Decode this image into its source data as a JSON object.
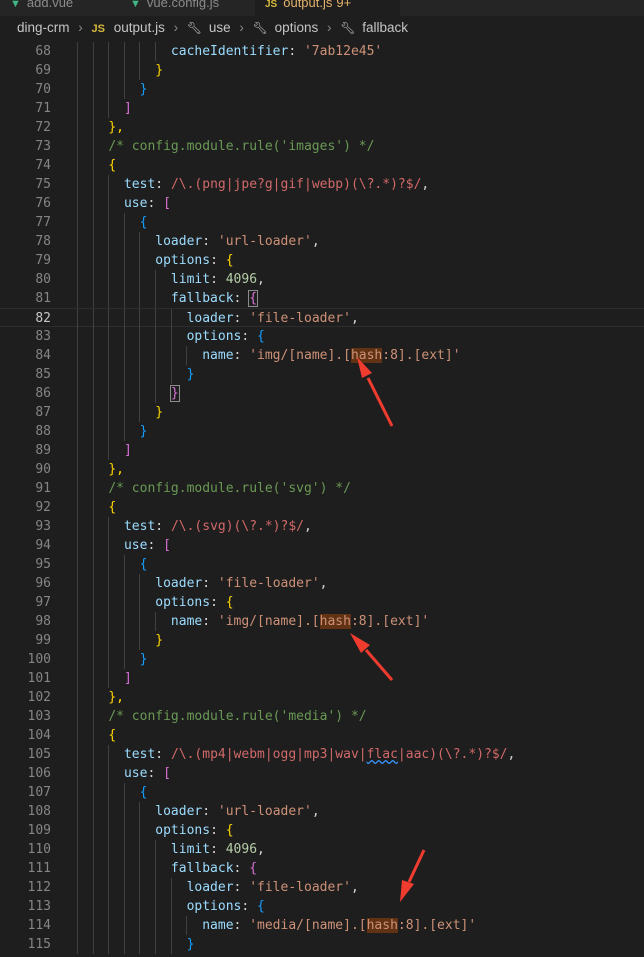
{
  "tabs": [
    {
      "name": "add.vue",
      "icon": "vue-icon",
      "active": false
    },
    {
      "name": "vue.config.js",
      "icon": "vue-icon",
      "active": false
    },
    {
      "name": "output.js",
      "icon": "js-icon",
      "active": true,
      "badge": "9+"
    }
  ],
  "breadcrumb": {
    "items": [
      "ding-crm",
      "output.js",
      "use",
      "options",
      "fallback"
    ],
    "file_icon": "JS"
  },
  "colors": {
    "keyword": "#9cdcfe",
    "string": "#ce9178",
    "number": "#b5cea8",
    "comment": "#6a9955",
    "regex": "#d16969",
    "bracket_gold": "#ffd700",
    "bracket_purple": "#da70d6",
    "bracket_blue": "#179fff",
    "arrow": "#ef3c2f",
    "highlight": "#613214"
  },
  "annotations": [
    "red-arrow",
    "red-arrow",
    "red-arrow"
  ],
  "lines": [
    {
      "n": "68",
      "t": [
        [
          "            ",
          ""
        ],
        [
          "cacheIdentifier",
          "k"
        ],
        [
          ": ",
          "p"
        ],
        [
          "'7ab12e45'",
          "s"
        ]
      ]
    },
    {
      "n": "69",
      "t": [
        [
          "          ",
          ""
        ],
        [
          "}",
          "y"
        ]
      ]
    },
    {
      "n": "70",
      "t": [
        [
          "        ",
          ""
        ],
        [
          "}",
          "b"
        ]
      ]
    },
    {
      "n": "71",
      "t": [
        [
          "      ",
          ""
        ],
        [
          "]",
          "m"
        ]
      ]
    },
    {
      "n": "72",
      "t": [
        [
          "    ",
          ""
        ],
        [
          "},",
          "y"
        ]
      ]
    },
    {
      "n": "73",
      "t": [
        [
          "    ",
          ""
        ],
        [
          "/* config.module.rule('images') */",
          "c"
        ]
      ]
    },
    {
      "n": "74",
      "t": [
        [
          "    ",
          ""
        ],
        [
          "{",
          "y"
        ]
      ]
    },
    {
      "n": "75",
      "t": [
        [
          "      ",
          ""
        ],
        [
          "test",
          "k"
        ],
        [
          ": ",
          "p"
        ],
        [
          "/\\.(png|jpe?g|gif|webp)(\\?.*)?$/",
          "r"
        ],
        [
          ",",
          "p"
        ]
      ]
    },
    {
      "n": "76",
      "t": [
        [
          "      ",
          ""
        ],
        [
          "use",
          "k"
        ],
        [
          ": ",
          "p"
        ],
        [
          "[",
          "m"
        ]
      ]
    },
    {
      "n": "77",
      "t": [
        [
          "        ",
          ""
        ],
        [
          "{",
          "b"
        ]
      ]
    },
    {
      "n": "78",
      "t": [
        [
          "          ",
          ""
        ],
        [
          "loader",
          "k"
        ],
        [
          ": ",
          "p"
        ],
        [
          "'url-loader'",
          "s"
        ],
        [
          ",",
          "p"
        ]
      ]
    },
    {
      "n": "79",
      "t": [
        [
          "          ",
          ""
        ],
        [
          "options",
          "k"
        ],
        [
          ": ",
          "p"
        ],
        [
          "{",
          "y"
        ]
      ]
    },
    {
      "n": "80",
      "t": [
        [
          "            ",
          ""
        ],
        [
          "limit",
          "k"
        ],
        [
          ": ",
          "p"
        ],
        [
          "4096",
          "n"
        ],
        [
          ",",
          "p"
        ]
      ]
    },
    {
      "n": "81",
      "t": [
        [
          "            ",
          ""
        ],
        [
          "fallback",
          "k"
        ],
        [
          ": ",
          "p"
        ],
        [
          "{",
          "mb"
        ]
      ]
    },
    {
      "n": "82",
      "t": [
        [
          "              ",
          ""
        ],
        [
          "loader",
          "k"
        ],
        [
          ": ",
          "p"
        ],
        [
          "'file-loader'",
          "s"
        ],
        [
          ",",
          "p"
        ]
      ],
      "current": true
    },
    {
      "n": "83",
      "t": [
        [
          "              ",
          ""
        ],
        [
          "options",
          "k"
        ],
        [
          ": ",
          "p"
        ],
        [
          "{",
          "b"
        ]
      ]
    },
    {
      "n": "84",
      "t": [
        [
          "                ",
          ""
        ],
        [
          "name",
          "k"
        ],
        [
          ": ",
          "p"
        ],
        [
          "'img/[name].[",
          "s"
        ],
        [
          "hash",
          "sh"
        ],
        [
          ":8].[ext]'",
          "s"
        ]
      ]
    },
    {
      "n": "85",
      "t": [
        [
          "              ",
          ""
        ],
        [
          "}",
          "b"
        ]
      ]
    },
    {
      "n": "86",
      "t": [
        [
          "            ",
          ""
        ],
        [
          "}",
          "mb"
        ]
      ]
    },
    {
      "n": "87",
      "t": [
        [
          "          ",
          ""
        ],
        [
          "}",
          "y"
        ]
      ]
    },
    {
      "n": "88",
      "t": [
        [
          "        ",
          ""
        ],
        [
          "}",
          "b"
        ]
      ]
    },
    {
      "n": "89",
      "t": [
        [
          "      ",
          ""
        ],
        [
          "]",
          "m"
        ]
      ]
    },
    {
      "n": "90",
      "t": [
        [
          "    ",
          ""
        ],
        [
          "},",
          "y"
        ]
      ]
    },
    {
      "n": "91",
      "t": [
        [
          "    ",
          ""
        ],
        [
          "/* config.module.rule('svg') */",
          "c"
        ]
      ]
    },
    {
      "n": "92",
      "t": [
        [
          "    ",
          ""
        ],
        [
          "{",
          "y"
        ]
      ]
    },
    {
      "n": "93",
      "t": [
        [
          "      ",
          ""
        ],
        [
          "test",
          "k"
        ],
        [
          ": ",
          "p"
        ],
        [
          "/\\.(svg)(\\?.*)?$/",
          "r"
        ],
        [
          ",",
          "p"
        ]
      ]
    },
    {
      "n": "94",
      "t": [
        [
          "      ",
          ""
        ],
        [
          "use",
          "k"
        ],
        [
          ": ",
          "p"
        ],
        [
          "[",
          "m"
        ]
      ]
    },
    {
      "n": "95",
      "t": [
        [
          "        ",
          ""
        ],
        [
          "{",
          "b"
        ]
      ]
    },
    {
      "n": "96",
      "t": [
        [
          "          ",
          ""
        ],
        [
          "loader",
          "k"
        ],
        [
          ": ",
          "p"
        ],
        [
          "'file-loader'",
          "s"
        ],
        [
          ",",
          "p"
        ]
      ]
    },
    {
      "n": "97",
      "t": [
        [
          "          ",
          ""
        ],
        [
          "options",
          "k"
        ],
        [
          ": ",
          "p"
        ],
        [
          "{",
          "y"
        ]
      ]
    },
    {
      "n": "98",
      "t": [
        [
          "            ",
          ""
        ],
        [
          "name",
          "k"
        ],
        [
          ": ",
          "p"
        ],
        [
          "'img/[name].[",
          "s"
        ],
        [
          "hash",
          "sh"
        ],
        [
          ":8].[ext]'",
          "s"
        ]
      ]
    },
    {
      "n": "99",
      "t": [
        [
          "          ",
          ""
        ],
        [
          "}",
          "y"
        ]
      ]
    },
    {
      "n": "100",
      "t": [
        [
          "        ",
          ""
        ],
        [
          "}",
          "b"
        ]
      ]
    },
    {
      "n": "101",
      "t": [
        [
          "      ",
          ""
        ],
        [
          "]",
          "m"
        ]
      ]
    },
    {
      "n": "102",
      "t": [
        [
          "    ",
          ""
        ],
        [
          "},",
          "y"
        ]
      ]
    },
    {
      "n": "103",
      "t": [
        [
          "    ",
          ""
        ],
        [
          "/* config.module.rule('media') */",
          "c"
        ]
      ]
    },
    {
      "n": "104",
      "t": [
        [
          "    ",
          ""
        ],
        [
          "{",
          "y"
        ]
      ]
    },
    {
      "n": "105",
      "t": [
        [
          "      ",
          ""
        ],
        [
          "test",
          "k"
        ],
        [
          ": ",
          "p"
        ],
        [
          "/\\.(mp4|webm|ogg|mp3|wav|",
          "r"
        ],
        [
          "flac",
          "rq"
        ],
        [
          "|aac)(\\?.*)?$/",
          "r"
        ],
        [
          ",",
          "p"
        ]
      ]
    },
    {
      "n": "106",
      "t": [
        [
          "      ",
          ""
        ],
        [
          "use",
          "k"
        ],
        [
          ": ",
          "p"
        ],
        [
          "[",
          "m"
        ]
      ]
    },
    {
      "n": "107",
      "t": [
        [
          "        ",
          ""
        ],
        [
          "{",
          "b"
        ]
      ]
    },
    {
      "n": "108",
      "t": [
        [
          "          ",
          ""
        ],
        [
          "loader",
          "k"
        ],
        [
          ": ",
          "p"
        ],
        [
          "'url-loader'",
          "s"
        ],
        [
          ",",
          "p"
        ]
      ]
    },
    {
      "n": "109",
      "t": [
        [
          "          ",
          ""
        ],
        [
          "options",
          "k"
        ],
        [
          ": ",
          "p"
        ],
        [
          "{",
          "y"
        ]
      ]
    },
    {
      "n": "110",
      "t": [
        [
          "            ",
          ""
        ],
        [
          "limit",
          "k"
        ],
        [
          ": ",
          "p"
        ],
        [
          "4096",
          "n"
        ],
        [
          ",",
          "p"
        ]
      ]
    },
    {
      "n": "111",
      "t": [
        [
          "            ",
          ""
        ],
        [
          "fallback",
          "k"
        ],
        [
          ": ",
          "p"
        ],
        [
          "{",
          "m"
        ]
      ]
    },
    {
      "n": "112",
      "t": [
        [
          "              ",
          ""
        ],
        [
          "loader",
          "k"
        ],
        [
          ": ",
          "p"
        ],
        [
          "'file-loader'",
          "s"
        ],
        [
          ",",
          "p"
        ]
      ]
    },
    {
      "n": "113",
      "t": [
        [
          "              ",
          ""
        ],
        [
          "options",
          "k"
        ],
        [
          ": ",
          "p"
        ],
        [
          "{",
          "b"
        ]
      ]
    },
    {
      "n": "114",
      "t": [
        [
          "                ",
          ""
        ],
        [
          "name",
          "k"
        ],
        [
          ": ",
          "p"
        ],
        [
          "'media/[name].[",
          "s"
        ],
        [
          "hash",
          "sh"
        ],
        [
          ":8].[ext]'",
          "s"
        ]
      ]
    },
    {
      "n": "115",
      "t": [
        [
          "              ",
          ""
        ],
        [
          "}",
          "b"
        ]
      ]
    }
  ]
}
